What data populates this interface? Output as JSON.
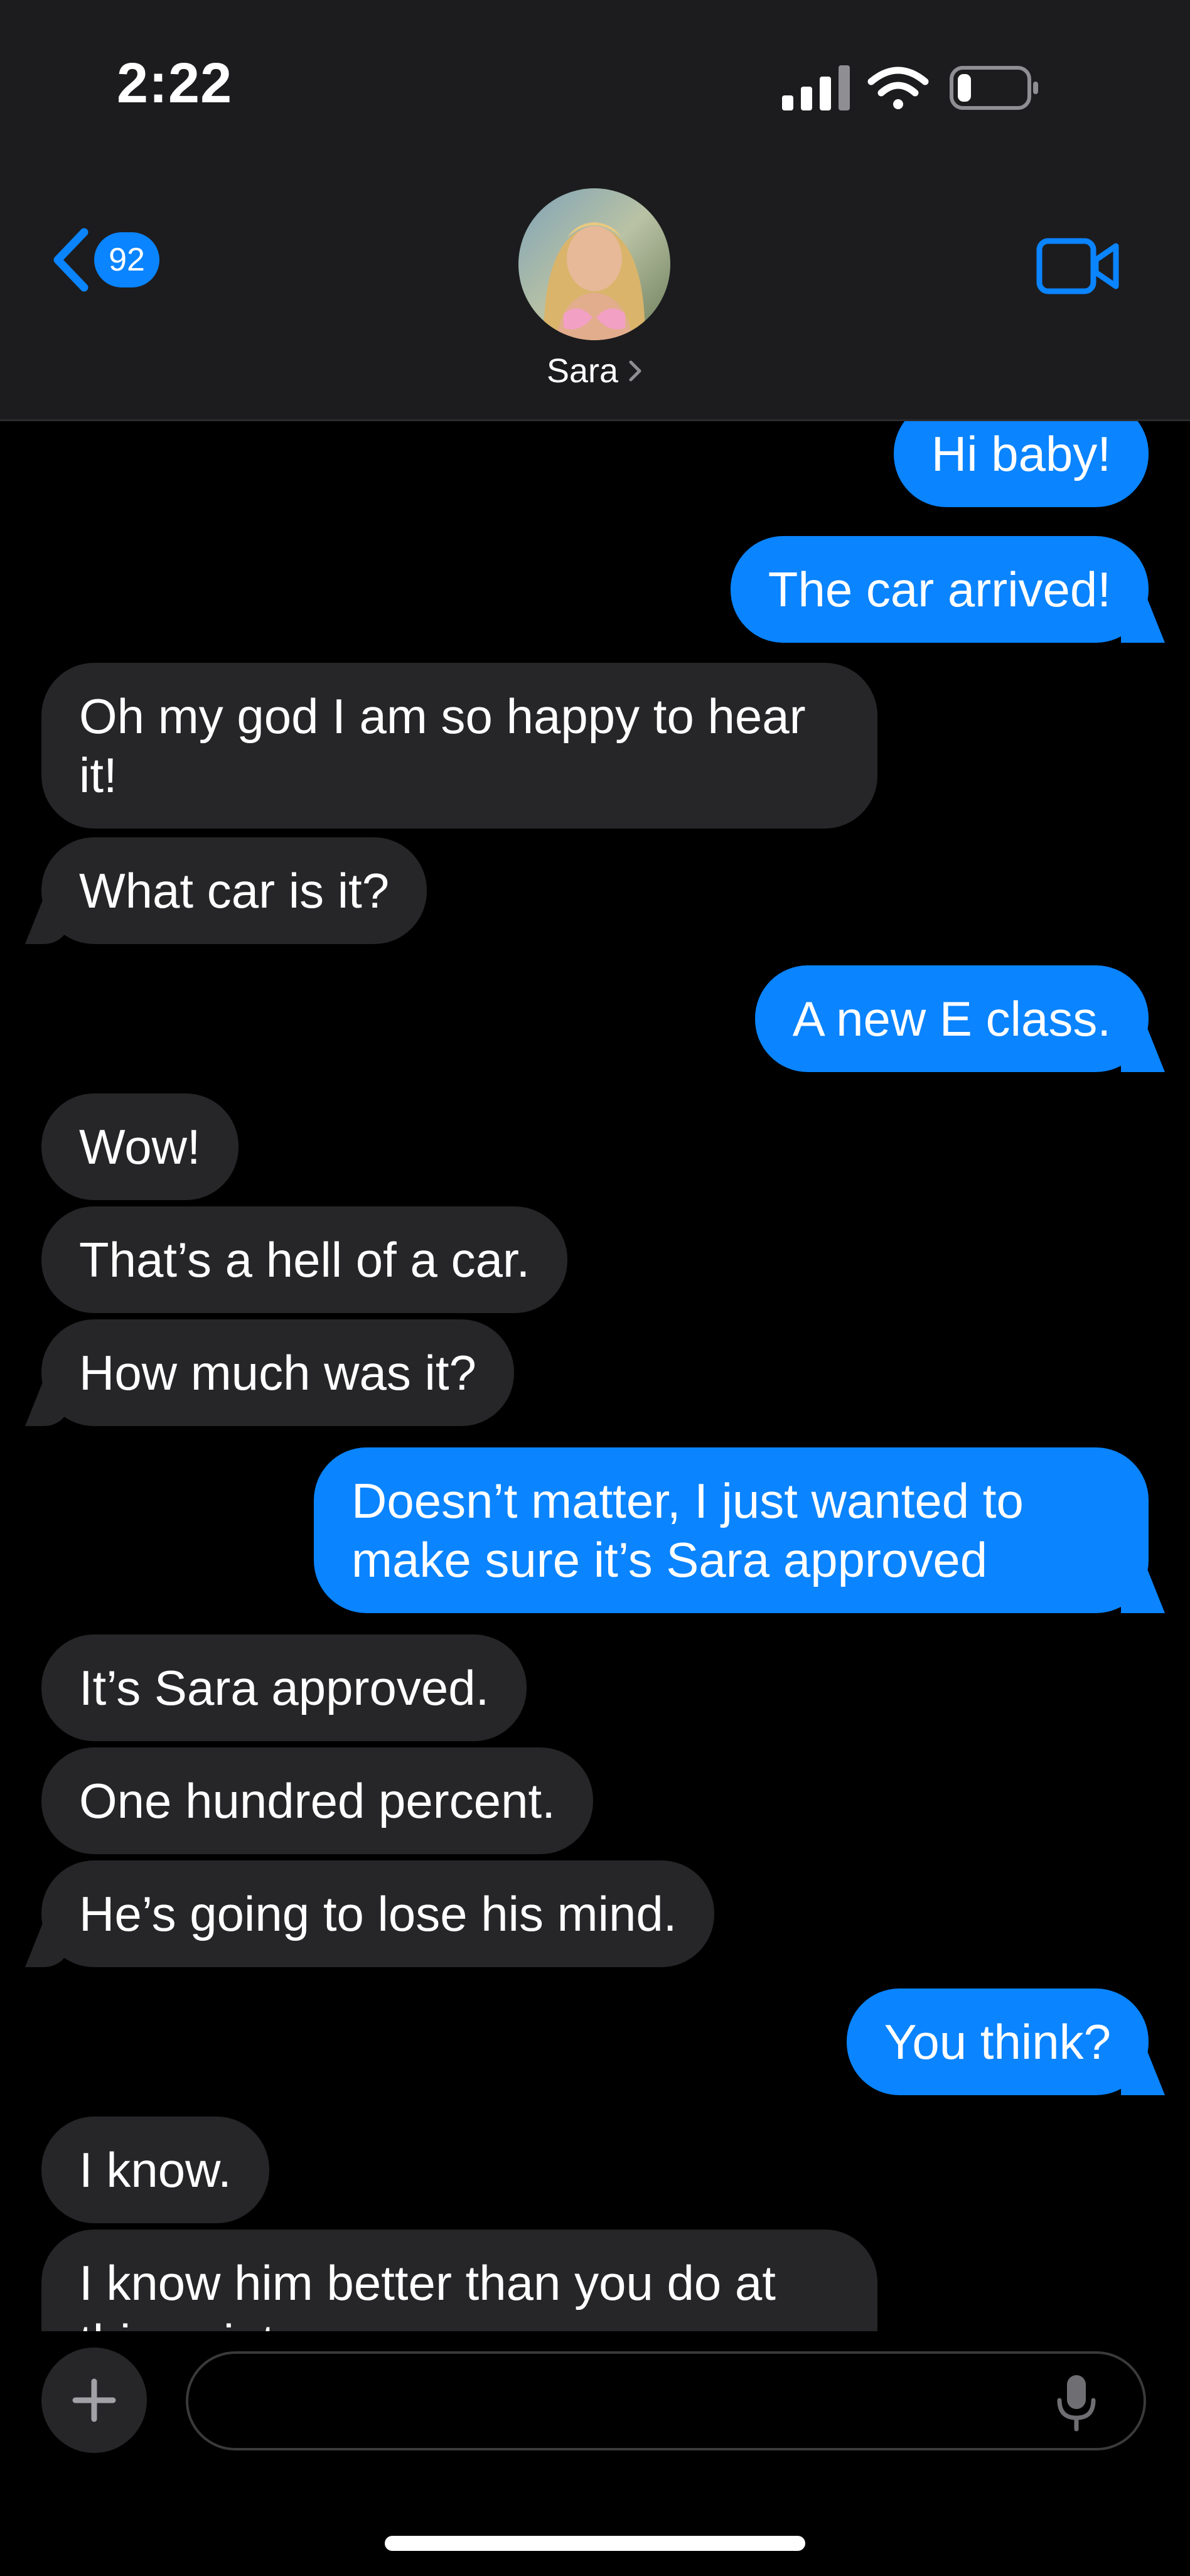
{
  "status_bar": {
    "time": "2:22",
    "signal_icon": "cellular-signal-icon",
    "wifi_icon": "wifi-icon",
    "battery_icon": "battery-icon",
    "battery_level": 0.2
  },
  "header": {
    "back_icon": "chevron-left-icon",
    "unread_count": "92",
    "contact_name": "Sara",
    "video_icon": "video-camera-icon"
  },
  "colors": {
    "accent": "#0a84ff",
    "incoming_bubble": "#262628",
    "header_bg": "#1c1c1e",
    "background": "#000000"
  },
  "messages": [
    {
      "direction": "out",
      "text": "Hi baby!"
    },
    {
      "direction": "out",
      "text": "The car arrived!"
    },
    {
      "direction": "in",
      "text": "Oh my god I am so happy to hear it!"
    },
    {
      "direction": "in",
      "text": "What car is it?"
    },
    {
      "direction": "out",
      "text": "A new E class."
    },
    {
      "direction": "in",
      "text": "Wow!"
    },
    {
      "direction": "in",
      "text": "That’s a hell of a car."
    },
    {
      "direction": "in",
      "text": "How much was it?"
    },
    {
      "direction": "out",
      "text": "Doesn’t matter, I just wanted to make sure it’s Sara approved"
    },
    {
      "direction": "in",
      "text": "It’s Sara approved."
    },
    {
      "direction": "in",
      "text": "One hundred percent."
    },
    {
      "direction": "in",
      "text": "He’s going to lose his mind."
    },
    {
      "direction": "out",
      "text": "You think?"
    },
    {
      "direction": "in",
      "text": "I know."
    },
    {
      "direction": "in",
      "text": "I know him better than you do at this point."
    }
  ],
  "composer": {
    "plus_icon": "plus-icon",
    "input_value": "",
    "mic_icon": "microphone-icon"
  }
}
